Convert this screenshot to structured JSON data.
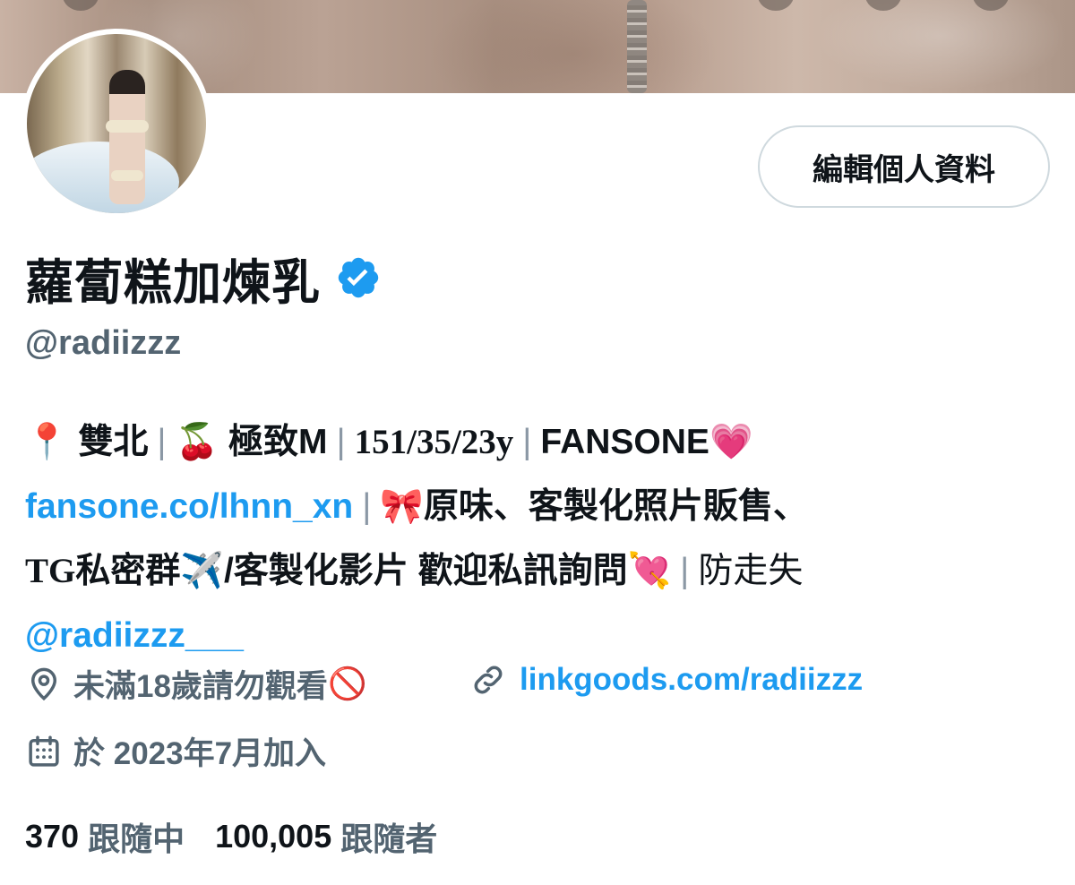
{
  "profile": {
    "display_name": "蘿蔔糕加煉乳",
    "handle": "@radiizzz",
    "verified": true,
    "edit_button_label": "編輯個人資料"
  },
  "bio": {
    "line1": {
      "pin": "📍",
      "location": "雙北",
      "sep1": "|",
      "cherry": "🍒",
      "trait": "極致M",
      "sep2": "|",
      "stats": "151/35/23y",
      "sep3": "|",
      "brand": "FANSONE",
      "heart": "💗"
    },
    "line2": {
      "link": "fansone.co/lhnn_xn",
      "sep": "|",
      "ribbon": "🎀",
      "text": "原味、客製化照片販售、"
    },
    "line3": {
      "tg": "TG",
      "text1": "私密群",
      "plane": "✈️",
      "text2": "/客製化影片 歡迎私訊詢問",
      "heart_arrow": "💘",
      "sep": "|",
      "text3": "防走失"
    },
    "line4": {
      "mention": "@radiizzz___"
    }
  },
  "meta": {
    "location_text": "未滿18歲請勿觀看",
    "no_entry": "🚫",
    "website": "linkgoods.com/radiizzz",
    "joined": "於 2023年7月加入"
  },
  "counts": {
    "following": "370",
    "following_label": "跟隨中",
    "followers": "100,005",
    "followers_label": "跟隨者"
  },
  "colors": {
    "link": "#1d9bf0",
    "secondary_text": "#536471",
    "primary_text": "#0f1419",
    "verified_badge": "#1d9bf0",
    "button_border": "#cfd9de"
  }
}
